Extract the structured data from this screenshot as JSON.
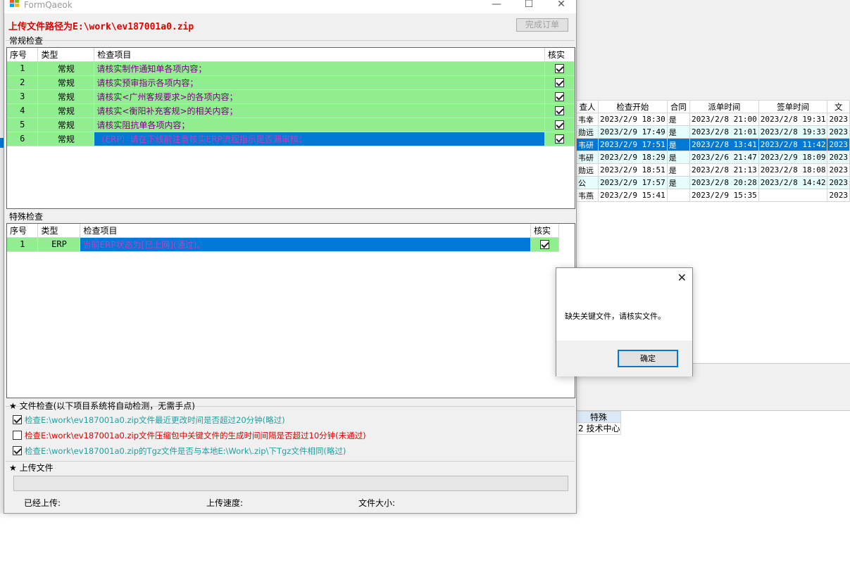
{
  "background": {
    "table": {
      "columns": [
        "查人",
        "检查开始",
        "合同",
        "派单时间",
        "签单时间",
        "文"
      ],
      "rows": [
        {
          "person": "韦幸",
          "start": "2023/2/9 18:30",
          "contract": "是",
          "dispatch": "2023/2/8 21:00",
          "sign": "2023/2/8 19:31",
          "doc": "2023"
        },
        {
          "person": "勋远",
          "start": "2023/2/9 17:49",
          "contract": "是",
          "dispatch": "2023/2/8 21:01",
          "sign": "2023/2/8 19:33",
          "doc": "2023"
        },
        {
          "person": "韦研",
          "start": "2023/2/9 17:51",
          "contract": "是",
          "dispatch": "2023/2/8 13:41",
          "sign": "2023/2/8 11:42",
          "doc": "2023"
        },
        {
          "person": "韦研",
          "start": "2023/2/9 18:29",
          "contract": "是",
          "dispatch": "2023/2/6 21:47",
          "sign": "2023/2/9 18:09",
          "doc": "2023"
        },
        {
          "person": "勋远",
          "start": "2023/2/9 18:51",
          "contract": "是",
          "dispatch": "2023/2/8 21:13",
          "sign": "2023/2/8 18:08",
          "doc": "2023"
        },
        {
          "person": "公",
          "start": "2023/2/9 17:57",
          "contract": "是",
          "dispatch": "2023/2/8 20:28",
          "sign": "2023/2/8 14:42",
          "doc": "2023"
        },
        {
          "person": "韦燕",
          "start": "2023/2/9 15:41",
          "contract": "",
          "dispatch": "2023/2/9 15:35",
          "sign": "",
          "doc": "2023"
        }
      ]
    },
    "special": {
      "header": "特殊",
      "cell": "2 技术中心"
    }
  },
  "window": {
    "title": "FormQaeok",
    "minimize": "—",
    "maximize": "☐",
    "close": "✕"
  },
  "upload_path": {
    "label": "上传文件路径为",
    "path": "E:\\work\\ev187001a0.zip"
  },
  "complete_button": "完成订单",
  "regular": {
    "group_label": "常规检查",
    "headers": {
      "seq": "序号",
      "type": "类型",
      "item": "检查项目",
      "verify": "核实"
    },
    "rows": [
      {
        "seq": "1",
        "type": "常规",
        "item": "请核实制作通知单各项内容；",
        "checked": true
      },
      {
        "seq": "2",
        "type": "常规",
        "item": "请核实预审指示各项内容；",
        "checked": true
      },
      {
        "seq": "3",
        "type": "常规",
        "item": "请核实<广州客规要求>的各项内容；",
        "checked": true
      },
      {
        "seq": "4",
        "type": "常规",
        "item": "请核实<衡阳补充客规>的相关内容；",
        "checked": true
      },
      {
        "seq": "5",
        "type": "常规",
        "item": "请核实阻抗单各项内容；",
        "checked": true
      },
      {
        "seq": "6",
        "type": "常规",
        "item": "（ERP）请在下线前注意核实ERP流程指示是否漏审核；",
        "checked": true
      }
    ]
  },
  "special": {
    "group_label": "特殊检查",
    "headers": {
      "seq": "序号",
      "type": "类型",
      "item": "检查项目",
      "verify": "核实"
    },
    "rows": [
      {
        "seq": "1",
        "type": "ERP",
        "item": "当前ERP状态为[已上网](通过)。",
        "checked": true
      }
    ]
  },
  "file_check": {
    "title": "★ 文件检查(以下项目系统将自动检测，无需手点)",
    "items": [
      {
        "text": "检查E:\\work\\ev187001a0.zip文件最近更改时间是否超过20分钟(略过)",
        "checked": true,
        "status_color": "#1fa0a0"
      },
      {
        "text": "检查E:\\work\\ev187001a0.zip文件压缩包中关键文件的生成时间间隔是否超过10分钟(未通过)",
        "checked": false,
        "status_color": "#e00000"
      },
      {
        "text": "检查E:\\work\\ev187001a0.zip的Tgz文件是否与本地E:\\Work\\.zip\\下Tgz文件相同(略过)",
        "checked": true,
        "status_color": "#1fa0a0"
      }
    ]
  },
  "upload": {
    "title": "★ 上传文件",
    "progress": 0,
    "uploaded_label": "已经上传:",
    "speed_label": "上传速度:",
    "size_label": "文件大小:"
  },
  "msgbox": {
    "message": "缺失关键文件，请核实文件。",
    "ok": "确定",
    "close": "✕"
  }
}
